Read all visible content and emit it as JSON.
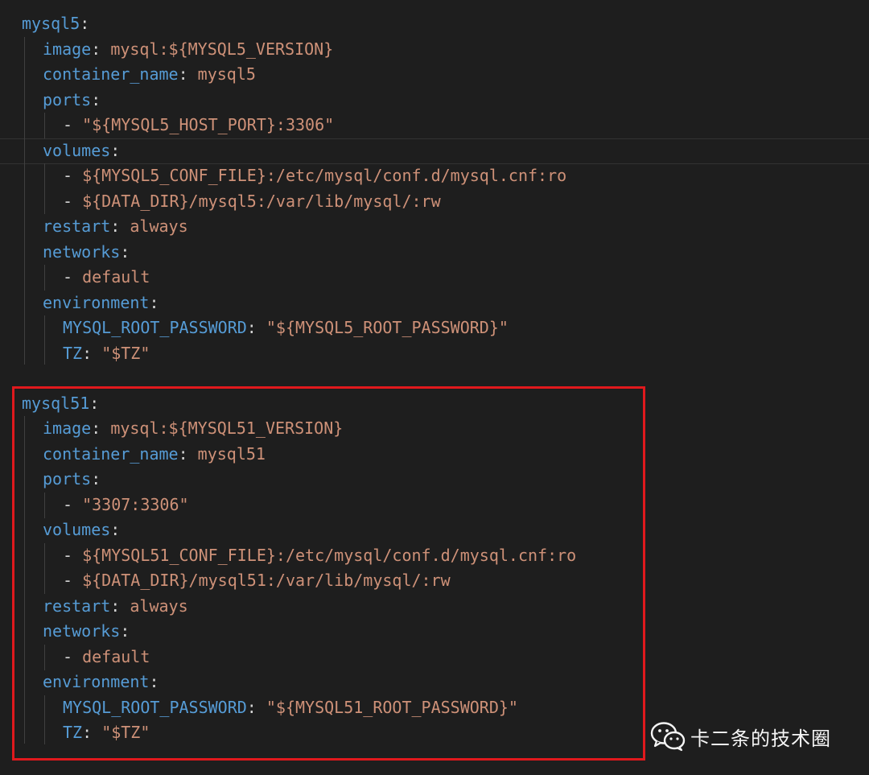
{
  "colors": {
    "background": "#1e1e1e",
    "key": "#569cd6",
    "string": "#ce9178",
    "punctuation": "#d4d4d4",
    "highlight_box": "#e0191d",
    "indent_guide": "#404040"
  },
  "watermark": {
    "text": "卡二条的技术圈",
    "icon": "wechat-icon"
  },
  "code": {
    "mysql5": {
      "service": "mysql5",
      "image_key": "image",
      "image_value": "mysql:${MYSQL5_VERSION}",
      "container_key": "container_name",
      "container_value": "mysql5",
      "ports_key": "ports",
      "port_item": "\"${MYSQL5_HOST_PORT}:3306\"",
      "volumes_key": "volumes",
      "volume_1": "${MYSQL5_CONF_FILE}:/etc/mysql/conf.d/mysql.cnf:ro",
      "volume_2": "${DATA_DIR}/mysql5:/var/lib/mysql/:rw",
      "restart_key": "restart",
      "restart_value": "always",
      "networks_key": "networks",
      "network_item": "default",
      "environment_key": "environment",
      "env_password_key": "MYSQL_ROOT_PASSWORD",
      "env_password_value": "\"${MYSQL5_ROOT_PASSWORD}\"",
      "env_tz_key": "TZ",
      "env_tz_value": "\"$TZ\""
    },
    "mysql51": {
      "service": "mysql51",
      "image_key": "image",
      "image_value": "mysql:${MYSQL51_VERSION}",
      "container_key": "container_name",
      "container_value": "mysql51",
      "ports_key": "ports",
      "port_item": "\"3307:3306\"",
      "volumes_key": "volumes",
      "volume_1": "${MYSQL51_CONF_FILE}:/etc/mysql/conf.d/mysql.cnf:ro",
      "volume_2": "${DATA_DIR}/mysql51:/var/lib/mysql/:rw",
      "restart_key": "restart",
      "restart_value": "always",
      "networks_key": "networks",
      "network_item": "default",
      "environment_key": "environment",
      "env_password_key": "MYSQL_ROOT_PASSWORD",
      "env_password_value": "\"${MYSQL51_ROOT_PASSWORD}\"",
      "env_tz_key": "TZ",
      "env_tz_value": "\"$TZ\""
    }
  }
}
